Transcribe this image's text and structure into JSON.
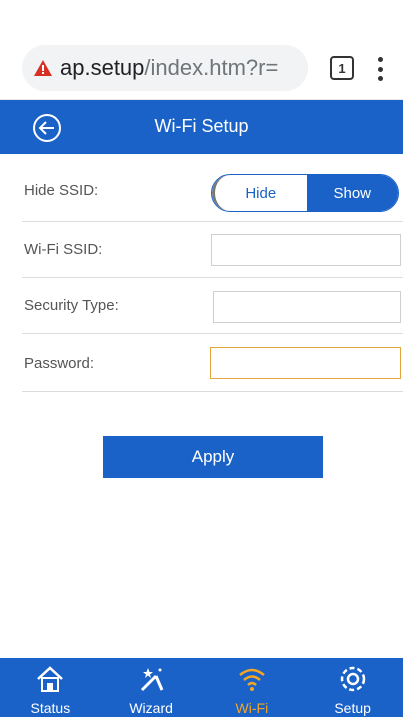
{
  "browser": {
    "url_host": "ap.setup",
    "url_path": "/index.htm?r=",
    "tab_count": "1",
    "warning_icon": "warning-triangle-icon",
    "warning_color": "#d93025"
  },
  "header": {
    "title": "Wi-Fi Setup",
    "back_icon": "back-arrow-icon",
    "color": "#1a62c8"
  },
  "form": {
    "hide_ssid": {
      "label": "Hide SSID:",
      "options": [
        "Hide",
        "Show"
      ],
      "selected": "Show"
    },
    "ssid": {
      "label": "Wi-Fi SSID:",
      "value": ""
    },
    "security_type": {
      "label": "Security Type:",
      "value": ""
    },
    "password": {
      "label": "Password:",
      "value": ""
    },
    "apply_label": "Apply"
  },
  "nav": {
    "items": [
      {
        "label": "Status",
        "icon": "home-icon"
      },
      {
        "label": "Wizard",
        "icon": "magic-wand-icon"
      },
      {
        "label": "Wi-Fi",
        "icon": "wifi-icon",
        "active": true
      },
      {
        "label": "Setup",
        "icon": "gear-icon"
      }
    ],
    "active_color": "#f5a623"
  }
}
